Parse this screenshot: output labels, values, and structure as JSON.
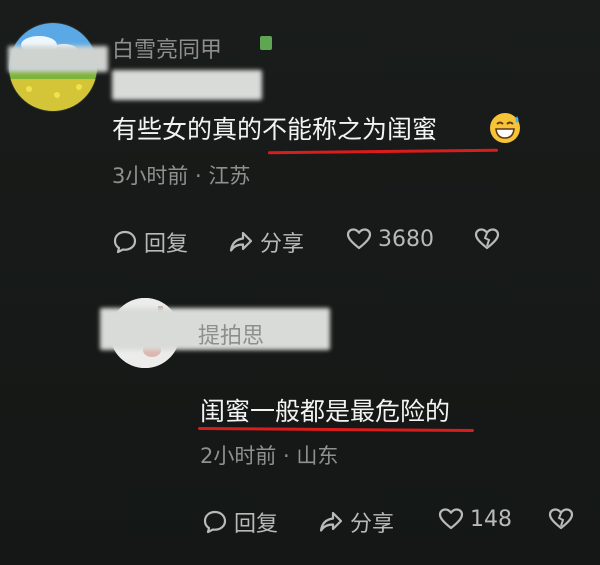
{
  "comments": [
    {
      "username": "白雪亮同甲",
      "text": "有些女的真的不能称之为闺蜜",
      "meta": "3小时前 · 江苏",
      "actions": {
        "reply_label": "回复",
        "share_label": "分享",
        "like_count": "3680"
      }
    },
    {
      "username": "提拍思",
      "text": "闺蜜一般都是最危险的",
      "meta": "2小时前 · 山东",
      "actions": {
        "reply_label": "回复",
        "share_label": "分享",
        "like_count": "148"
      }
    }
  ],
  "icons": {
    "reply": "speech-bubble-icon",
    "share": "share-arrow-icon",
    "like": "heart-icon",
    "dislike": "broken-heart-icon",
    "emoji": "sweat-grin-emoji-icon"
  },
  "colors": {
    "background": "#171a18",
    "text": "#f2f3f2",
    "meta": "#8e918f",
    "underline": "#d91c1c"
  }
}
